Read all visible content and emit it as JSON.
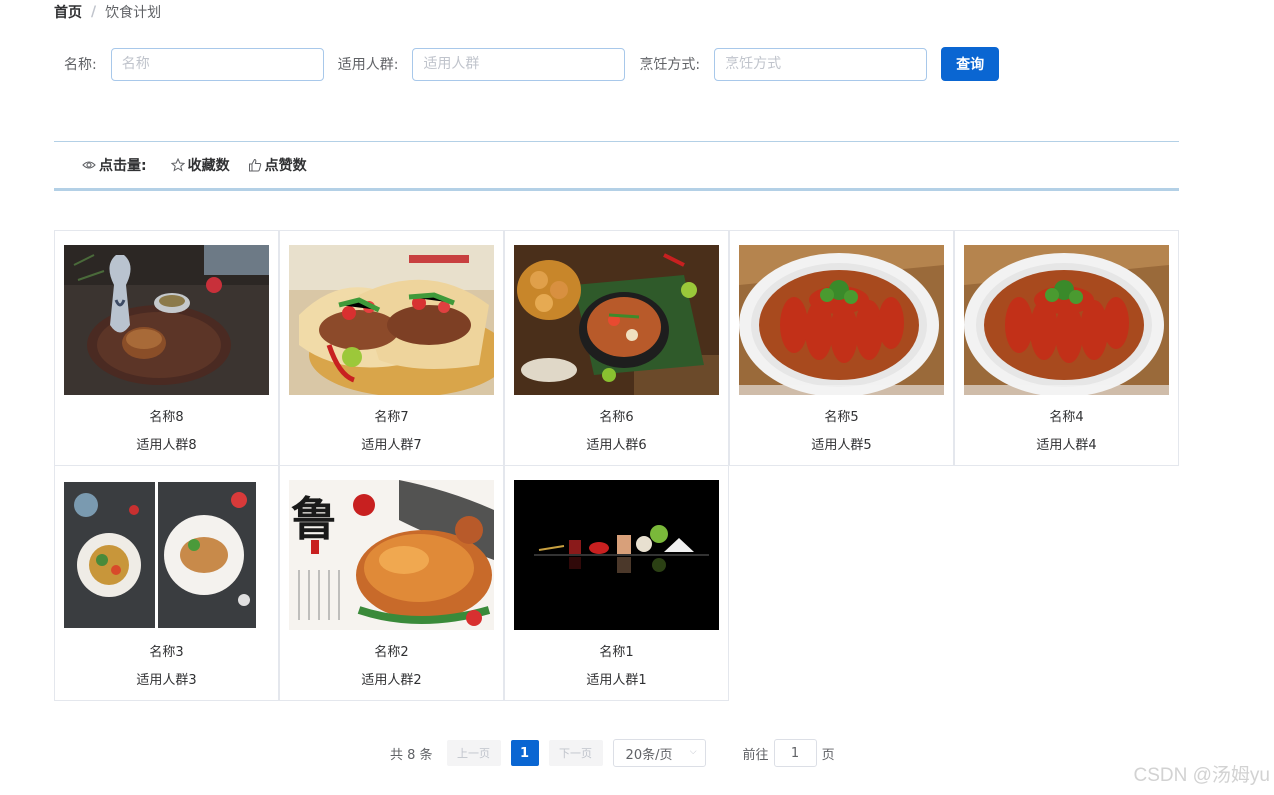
{
  "breadcrumb": {
    "home": "首页",
    "separator": "/",
    "current": "饮食计划"
  },
  "search": {
    "name_label": "名称:",
    "name_placeholder": "名称",
    "crowd_label": "适用人群:",
    "crowd_placeholder": "适用人群",
    "cook_label": "烹饪方式:",
    "cook_placeholder": "烹饪方式",
    "button_label": "查询"
  },
  "sort": {
    "clicks_label": "点击量:",
    "favorites_label": "收藏数",
    "likes_label": "点赞数"
  },
  "cards": [
    {
      "name": "名称8",
      "crowd": "适用人群8",
      "image": "sake-and-dessert-plate"
    },
    {
      "name": "名称7",
      "crowd": "适用人群7",
      "image": "tacos"
    },
    {
      "name": "名称6",
      "crowd": "适用人群6",
      "image": "hotpot-spread"
    },
    {
      "name": "名称5",
      "crowd": "适用人群5",
      "image": "crayfish-plate"
    },
    {
      "name": "名称4",
      "crowd": "适用人群4",
      "image": "crayfish-plate"
    },
    {
      "name": "名称3",
      "crowd": "适用人群3",
      "image": "plated-dishes"
    },
    {
      "name": "名称2",
      "crowd": "适用人群2",
      "image": "roast-chicken"
    },
    {
      "name": "名称1",
      "crowd": "适用人群1",
      "image": "fine-dining-black"
    }
  ],
  "pagination": {
    "total": "共 8 条",
    "prev": "上一页",
    "current_page": "1",
    "next": "下一页",
    "page_size": "20条/页",
    "goto_prefix": "前往",
    "goto_value": "1",
    "goto_suffix": "页"
  },
  "watermark": "CSDN @汤姆yu"
}
